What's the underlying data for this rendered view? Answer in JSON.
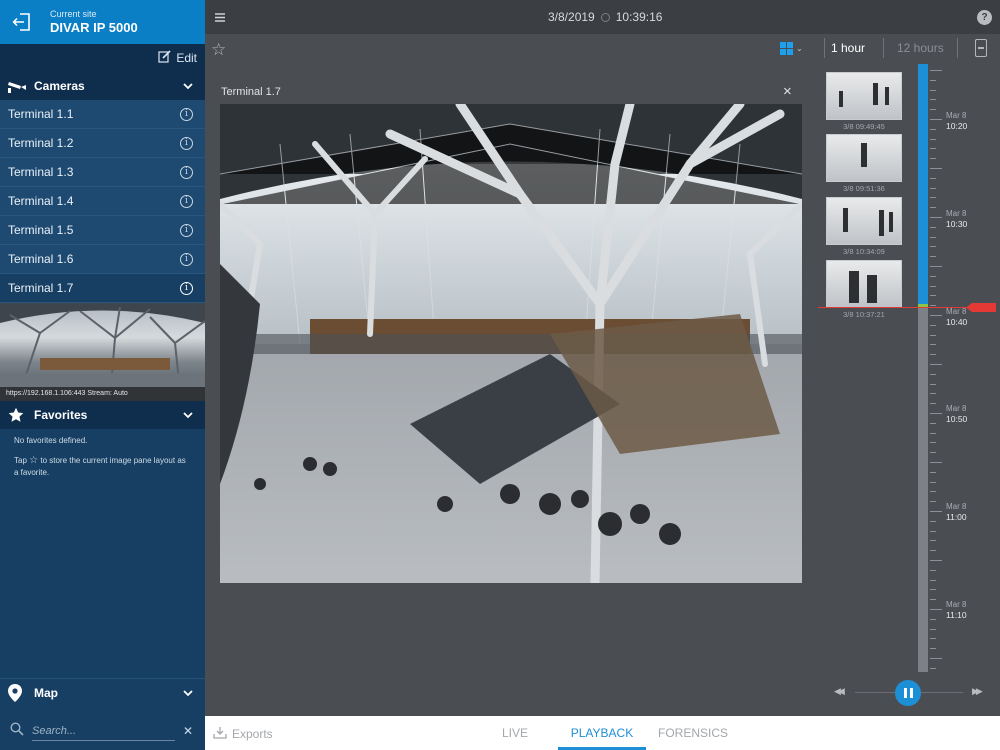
{
  "site": {
    "label": "Current site",
    "name": "DIVAR IP 5000"
  },
  "sidebar": {
    "edit_label": "Edit",
    "cameras_label": "Cameras",
    "cameras": [
      {
        "label": "Terminal 1.1"
      },
      {
        "label": "Terminal 1.2"
      },
      {
        "label": "Terminal 1.3"
      },
      {
        "label": "Terminal 1.4"
      },
      {
        "label": "Terminal 1.5"
      },
      {
        "label": "Terminal 1.6"
      },
      {
        "label": "Terminal 1.7"
      }
    ],
    "active_camera": "Terminal 1.7",
    "stream_info": "https://192.168.1.106:443 Stream: Auto",
    "favorites_label": "Favorites",
    "favorites_empty": "No favorites defined.",
    "favorites_hint_pre": "Tap",
    "favorites_hint_post": "to store the current image pane layout as a favorite.",
    "map_label": "Map",
    "search_placeholder": "Search..."
  },
  "header": {
    "date": "3/8/2019",
    "time": "10:39:16",
    "help": "?"
  },
  "toolbar": {
    "range_1h": "1 hour",
    "range_12h": "12 hours"
  },
  "pane": {
    "title": "Terminal 1.7",
    "close": "×"
  },
  "timeline": {
    "thumbnails": [
      {
        "caption": "3/8 09:49:45"
      },
      {
        "caption": "3/8 09:51:36"
      },
      {
        "caption": "3/8 10:34:09"
      },
      {
        "caption": "3/8 10:37:21"
      }
    ],
    "labels": [
      {
        "date": "Mar 8",
        "time": "10:20"
      },
      {
        "date": "Mar 8",
        "time": "10:30"
      },
      {
        "date": "Mar 8",
        "time": "10:40"
      },
      {
        "date": "Mar 8",
        "time": "10:50"
      },
      {
        "date": "Mar 8",
        "time": "11:00"
      },
      {
        "date": "Mar 8",
        "time": "11:10"
      }
    ]
  },
  "bottom": {
    "exports": "Exports",
    "tab_live": "LIVE",
    "tab_playback": "PLAYBACK",
    "tab_forensics": "FORENSICS",
    "active_tab": "PLAYBACK"
  },
  "colors": {
    "accent": "#1d8fd6",
    "site_bar": "#0b7fc6",
    "sidebar": "#173f63",
    "recording": "#1d8fd6",
    "marker": "#e53935"
  }
}
